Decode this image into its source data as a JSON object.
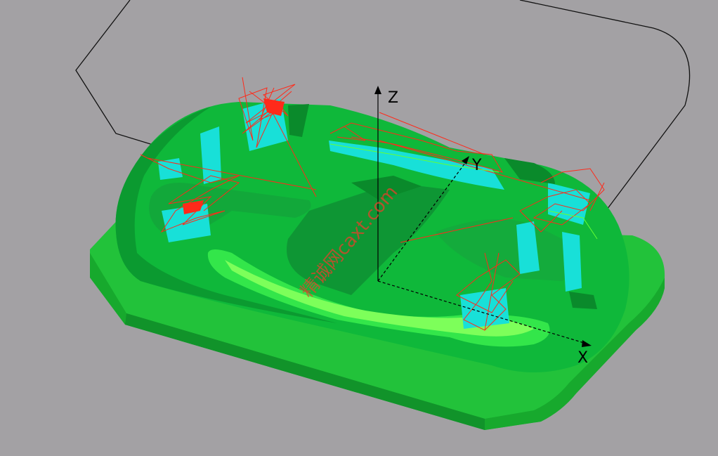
{
  "view": {
    "background_color": "#a3a1a4",
    "part_colors": {
      "base": "#2ecc3a",
      "base_dark": "#1f9f2e",
      "top": "#0fbf3a",
      "cavity": "#14a33a",
      "highlight": "#7dff5a",
      "cyan": "#18e0d8",
      "toolpath": "#ff2a1a",
      "boundary": "#111111"
    }
  },
  "axes": {
    "z_label": "Z",
    "y_label": "Y",
    "x_label": "X"
  },
  "watermark": {
    "text": "精诚网caxt.com"
  }
}
